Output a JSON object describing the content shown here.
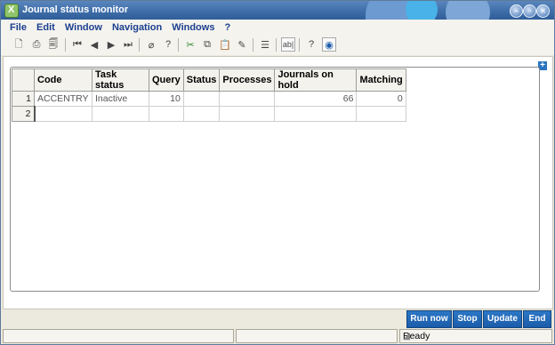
{
  "window": {
    "title": "Journal status monitor"
  },
  "menu": [
    {
      "label": "File"
    },
    {
      "label": "Edit"
    },
    {
      "label": "Window"
    },
    {
      "label": "Navigation"
    },
    {
      "label": "Windows"
    },
    {
      "label": "?"
    }
  ],
  "toolbar": {
    "text_button_label": "ab|"
  },
  "grid": {
    "columns": [
      "Code",
      "Task status",
      "Query",
      "Status",
      "Processes",
      "Journals on hold",
      "Matching"
    ],
    "rows": [
      {
        "num": "1",
        "cells": [
          "ACCENTRY",
          "Inactive",
          "10",
          "",
          "",
          "66",
          "0"
        ]
      },
      {
        "num": "2",
        "cells": [
          "",
          "",
          "",
          "",
          "",
          "",
          ""
        ]
      }
    ]
  },
  "actions": {
    "run_now": "Run now",
    "stop": "Stop",
    "update": "Update",
    "end": "End"
  },
  "status": {
    "text": "Ready"
  }
}
